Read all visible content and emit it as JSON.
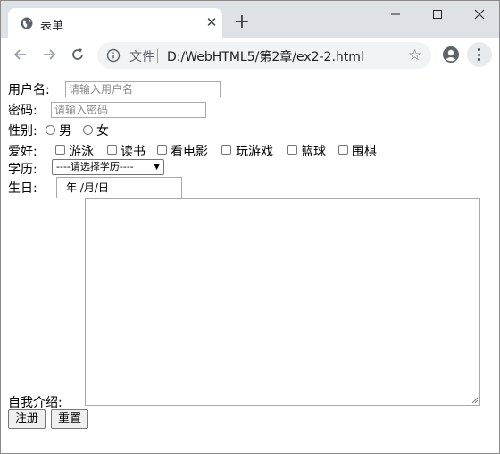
{
  "browser": {
    "tab_title": "表单",
    "tab_close": "✕",
    "new_tab": "+",
    "omnibox_file_label": "文件",
    "url": "D:/WebHTML5/第2章/ex2-2.html",
    "accent": "#dee1e6"
  },
  "form": {
    "username_label": "用户名:",
    "username_placeholder": "请输入用户名",
    "password_label": "密码:",
    "password_placeholder": "请输入密码",
    "gender_label": "性别:",
    "gender_options": [
      "男",
      "女"
    ],
    "hobby_label": "爱好:",
    "hobbies": [
      "游泳",
      "读书",
      "看电影",
      "玩游戏",
      "篮球",
      "围棋"
    ],
    "education_label": "学历:",
    "education_selected": "----请选择学历----",
    "birthday_label": "生日:",
    "birthday_value": "年 /月/日",
    "intro_label": "自我介绍:",
    "submit_label": "注册",
    "reset_label": "重置"
  }
}
